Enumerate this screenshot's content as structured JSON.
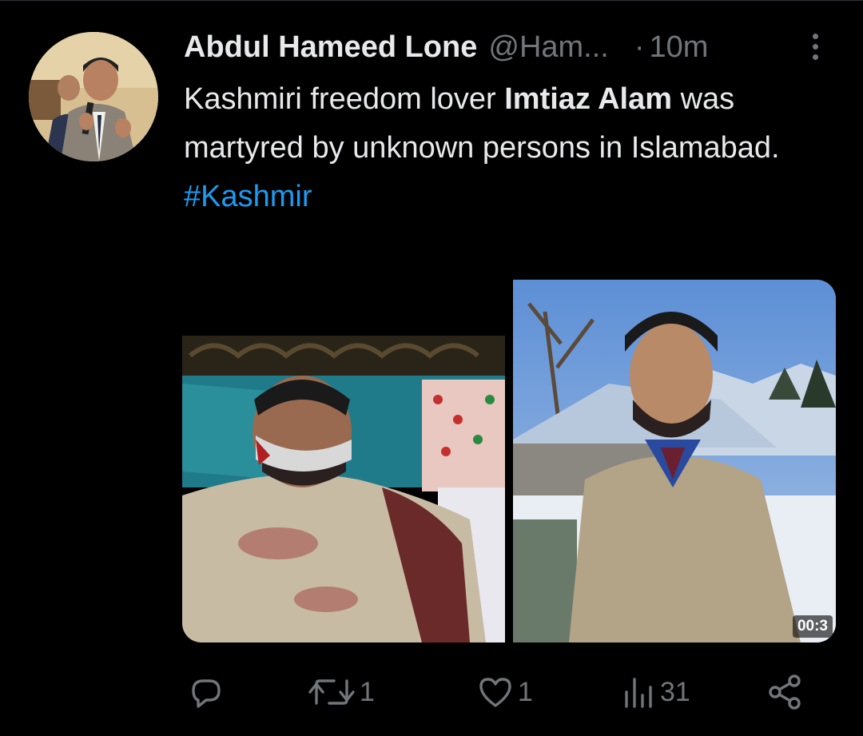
{
  "tweet": {
    "display_name": "Abdul Hameed Lone",
    "handle": "@Ham...",
    "separator": "·",
    "time": "10m",
    "text": {
      "part1": "Kashmiri freedom lover ",
      "bold": "Imtiaz Alam",
      "part2": " was martyred by unknown persons in Islamabad.",
      "hashtag": "#Kashmir"
    },
    "media": {
      "video_timer": "00:3"
    }
  },
  "actions": {
    "reply": {
      "icon": "reply-icon",
      "count": ""
    },
    "retweet": {
      "icon": "retweet-icon",
      "count": "1"
    },
    "like": {
      "icon": "heart-icon",
      "count": "1"
    },
    "views": {
      "icon": "views-chart-icon",
      "count": "31"
    },
    "share": {
      "icon": "share-icon",
      "count": ""
    }
  },
  "colors": {
    "background": "#000000",
    "text": "#e7e9ea",
    "muted": "#71767b",
    "link": "#1d9bf0"
  }
}
